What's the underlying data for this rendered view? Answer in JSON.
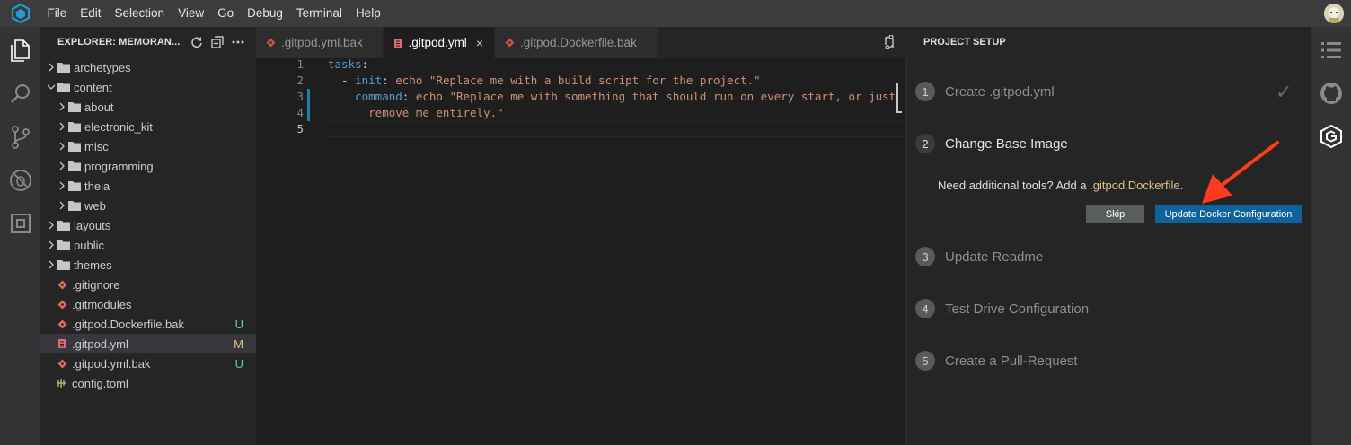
{
  "menubar": {
    "items": [
      "File",
      "Edit",
      "Selection",
      "View",
      "Go",
      "Debug",
      "Terminal",
      "Help"
    ]
  },
  "activitybar": {
    "icons": [
      "files-icon",
      "search-icon",
      "source-control-icon",
      "debug-icon",
      "extensions-icon"
    ]
  },
  "sidebar": {
    "title": "EXPLORER: MEMORAN...",
    "tree": [
      {
        "label": "archetypes",
        "type": "folder",
        "depth": 0,
        "expanded": false
      },
      {
        "label": "content",
        "type": "folder",
        "depth": 0,
        "expanded": true
      },
      {
        "label": "about",
        "type": "folder",
        "depth": 1,
        "expanded": false
      },
      {
        "label": "electronic_kit",
        "type": "folder",
        "depth": 1,
        "expanded": false
      },
      {
        "label": "misc",
        "type": "folder",
        "depth": 1,
        "expanded": false
      },
      {
        "label": "programming",
        "type": "folder",
        "depth": 1,
        "expanded": false
      },
      {
        "label": "theia",
        "type": "folder",
        "depth": 1,
        "expanded": false
      },
      {
        "label": "web",
        "type": "folder",
        "depth": 1,
        "expanded": false
      },
      {
        "label": "layouts",
        "type": "folder",
        "depth": 0,
        "expanded": false
      },
      {
        "label": "public",
        "type": "folder",
        "depth": 0,
        "expanded": false
      },
      {
        "label": "themes",
        "type": "folder",
        "depth": 0,
        "expanded": false
      },
      {
        "label": ".gitignore",
        "type": "git",
        "depth": 0,
        "decor": ""
      },
      {
        "label": ".gitmodules",
        "type": "git",
        "depth": 0,
        "decor": ""
      },
      {
        "label": ".gitpod.Dockerfile.bak",
        "type": "git",
        "depth": 0,
        "decor": "U"
      },
      {
        "label": ".gitpod.yml",
        "type": "yml",
        "depth": 0,
        "decor": "M",
        "selected": true
      },
      {
        "label": ".gitpod.yml.bak",
        "type": "git",
        "depth": 0,
        "decor": "U"
      },
      {
        "label": "config.toml",
        "type": "toml",
        "depth": 0,
        "decor": ""
      }
    ]
  },
  "tabs": [
    {
      "label": ".gitpod.yml.bak",
      "active": false
    },
    {
      "label": ".gitpod.yml",
      "active": true,
      "close": "×"
    },
    {
      "label": ".gitpod.Dockerfile.bak",
      "active": false
    }
  ],
  "editor": {
    "line_numbers": [
      "1",
      "2",
      "3",
      "4",
      "5"
    ],
    "lines": [
      {
        "segments": [
          {
            "t": "tasks",
            "c": "k"
          },
          {
            "t": ":",
            "c": "p"
          }
        ]
      },
      {
        "segments": [
          {
            "t": "  - ",
            "c": "p"
          },
          {
            "t": "init",
            "c": "k"
          },
          {
            "t": ": ",
            "c": "p"
          },
          {
            "t": "echo \"Replace me with a build script for the project.\"",
            "c": "s"
          }
        ]
      },
      {
        "segments": [
          {
            "t": "    ",
            "c": "p"
          },
          {
            "t": "command",
            "c": "k"
          },
          {
            "t": ": ",
            "c": "p"
          },
          {
            "t": "echo \"Replace me with something that should run on every start, or just",
            "c": "s"
          }
        ]
      },
      {
        "segments": [
          {
            "t": "      remove me entirely.\"",
            "c": "s"
          }
        ]
      },
      {
        "segments": []
      }
    ]
  },
  "panel": {
    "title": "PROJECT SETUP",
    "steps": [
      {
        "num": "1",
        "label": "Create .gitpod.yml",
        "done": true
      },
      {
        "num": "2",
        "label": "Change Base Image",
        "current": true
      },
      {
        "num": "3",
        "label": "Update Readme"
      },
      {
        "num": "4",
        "label": "Test Drive Configuration"
      },
      {
        "num": "5",
        "label": "Create a Pull-Request"
      }
    ],
    "check": "✓",
    "desc_prefix": "Need additional tools? Add a ",
    "desc_highlight": ".gitpod.Dockerfile",
    "desc_suffix": ".",
    "skip_label": "Skip",
    "update_label": "Update Docker Configuration"
  },
  "colors": {
    "accent": "#0e639c",
    "untracked": "#73c991",
    "modified": "#e2c08d",
    "arrow": "#ff3b1f"
  }
}
